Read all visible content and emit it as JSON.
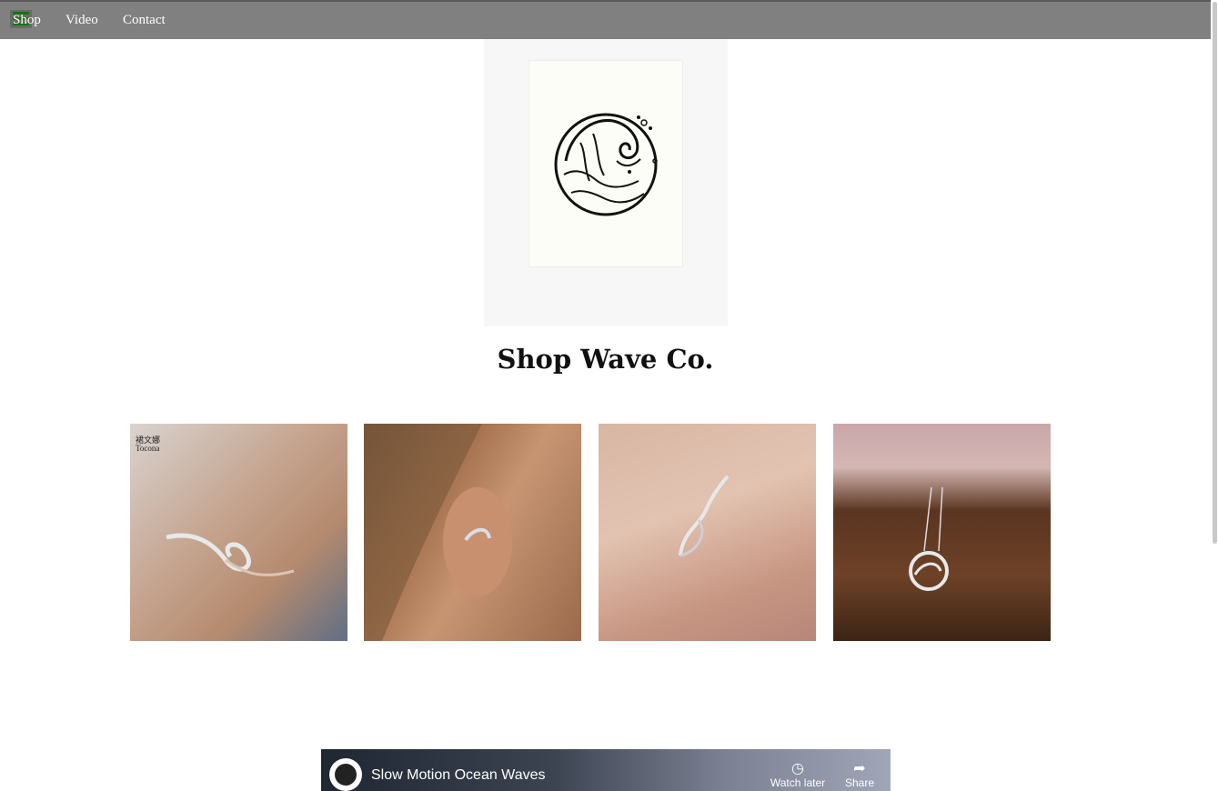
{
  "nav": {
    "items": [
      {
        "label": "Shop"
      },
      {
        "label": "Video"
      },
      {
        "label": "Contact"
      }
    ]
  },
  "hero": {
    "title": "Shop Wave Co."
  },
  "products": [
    {
      "name": "wave-bracelet",
      "watermark_top": "裙文娜",
      "watermark": "Tocona"
    },
    {
      "name": "wave-earring"
    },
    {
      "name": "wave-ring"
    },
    {
      "name": "wave-necklace"
    }
  ],
  "video": {
    "title": "Slow Motion Ocean Waves",
    "watch_later": "Watch later",
    "share": "Share"
  },
  "colors": {
    "nav_bg": "#808080",
    "menu_icon": "#0a7a0a"
  }
}
